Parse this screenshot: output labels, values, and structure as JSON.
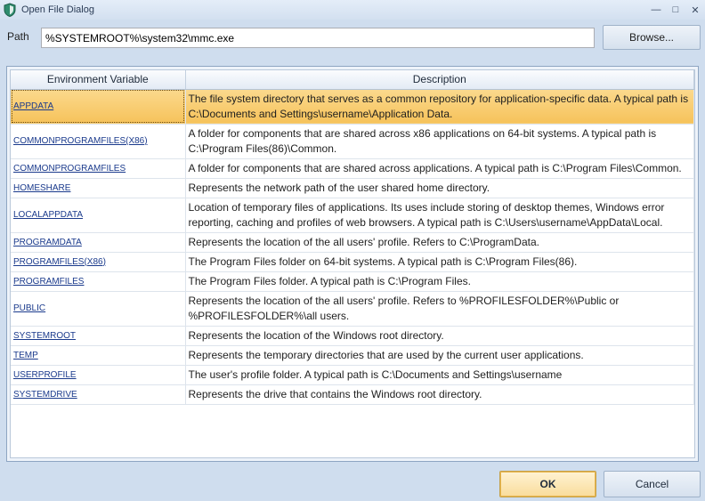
{
  "window": {
    "title": "Open File Dialog",
    "minimize_glyph": "—",
    "maximize_glyph": "□",
    "close_glyph": "✕"
  },
  "path": {
    "label": "Path",
    "value": "%SYSTEMROOT%\\system32\\mmc.exe",
    "browse_label": "Browse..."
  },
  "grid": {
    "columns": [
      "Environment Variable",
      "Description"
    ],
    "selected_index": 0,
    "rows": [
      {
        "var": "APPDATA",
        "desc": "The file system directory that serves as a common repository for application-specific data. A typical path is C:\\Documents and Settings\\username\\Application Data."
      },
      {
        "var": "COMMONPROGRAMFILES(X86)",
        "desc": "A folder for components that are shared across x86 applications on 64-bit systems. A typical path is C:\\Program Files(86)\\Common."
      },
      {
        "var": "COMMONPROGRAMFILES",
        "desc": " A folder for components that are shared across applications. A typical path is C:\\Program Files\\Common."
      },
      {
        "var": "HOMESHARE",
        "desc": "Represents the network path of the user shared home directory."
      },
      {
        "var": "LOCALAPPDATA",
        "desc": "Location of temporary files of applications. Its uses include storing of desktop themes, Windows error reporting, caching and profiles of web browsers. A typical path is C:\\Users\\username\\AppData\\Local."
      },
      {
        "var": "PROGRAMDATA",
        "desc": "Represents the location of the all users' profile. Refers to C:\\ProgramData."
      },
      {
        "var": "PROGRAMFILES(X86)",
        "desc": "The Program Files folder on 64-bit systems. A typical path is C:\\Program Files(86)."
      },
      {
        "var": "PROGRAMFILES",
        "desc": "The Program Files folder. A typical path is C:\\Program Files."
      },
      {
        "var": "PUBLIC",
        "desc": "Represents the location of the all users' profile. Refers to %PROFILESFOLDER%\\Public or %PROFILESFOLDER%\\all users."
      },
      {
        "var": "SYSTEMROOT",
        "desc": "Represents the location of the Windows root directory."
      },
      {
        "var": "TEMP",
        "desc": "Represents the temporary directories that are used by the current user applications."
      },
      {
        "var": "USERPROFILE",
        "desc": "The user's profile folder. A typical path is C:\\Documents and Settings\\username"
      },
      {
        "var": "SYSTEMDRIVE",
        "desc": "Represents the drive that contains the Windows root directory."
      }
    ]
  },
  "buttons": {
    "ok": "OK",
    "cancel": "Cancel"
  },
  "colors": {
    "selection": "#f6c25a",
    "link": "#1a3a8c",
    "window_bg": "#cfddee"
  }
}
